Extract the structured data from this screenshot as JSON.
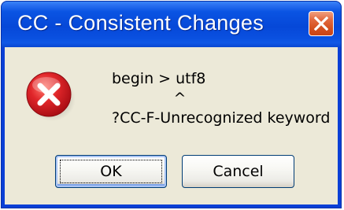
{
  "dialog": {
    "title": "CC - Consistent Changes",
    "close_icon": "close-icon",
    "icon": "error-icon",
    "message_lines": [
      "begin > utf8",
      "             ^",
      "?CC-F-Unrecognized keyword"
    ],
    "buttons": {
      "ok_label": "OK",
      "cancel_label": "Cancel"
    }
  },
  "colors": {
    "titlebar": "#0a54e3",
    "client": "#ece9d8",
    "close_button": "#d4501f",
    "error_red": "#d7202a"
  }
}
